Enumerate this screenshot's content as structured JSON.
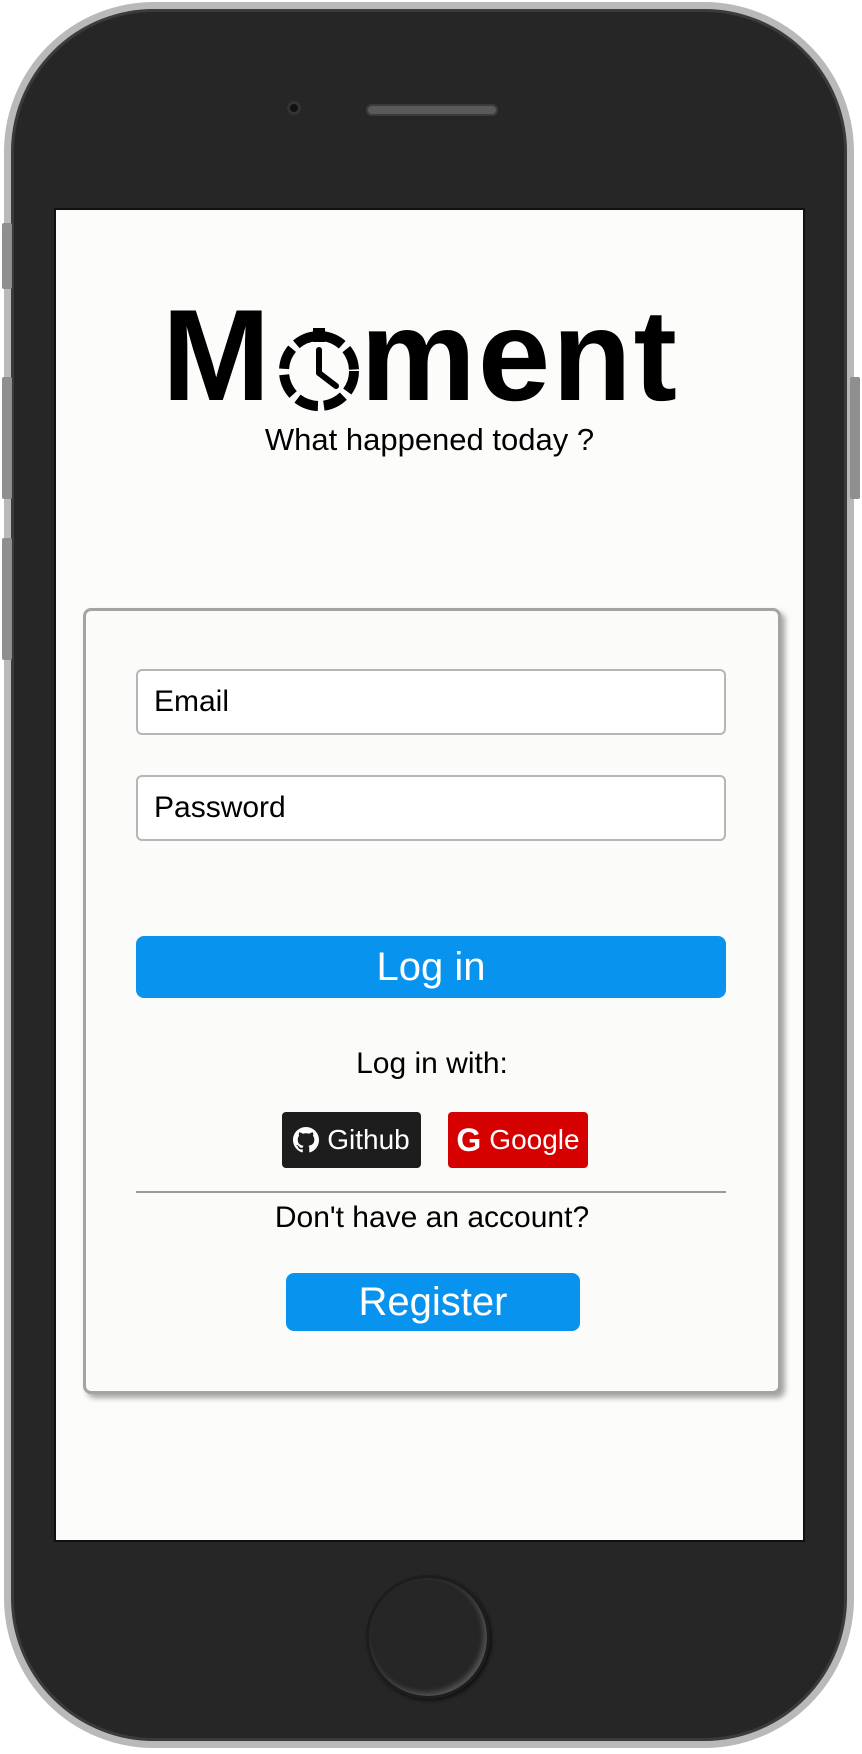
{
  "app": {
    "logo_text": "Moment",
    "tagline": "What happened today ?"
  },
  "login_form": {
    "email_placeholder": "Email",
    "password_placeholder": "Password",
    "login_label": "Log in",
    "login_with_label": "Log in with:",
    "github_label": "Github",
    "google_label": "Google",
    "no_account_text": "Don't have an account?",
    "register_label": "Register"
  },
  "icons": {
    "clock": "clock-icon",
    "github": "github-icon",
    "google": "google-icon"
  },
  "colors": {
    "primary": "#0894ee",
    "github": "#1d1d1d",
    "google": "#d50000",
    "phone_body": "#262626",
    "phone_bezel": "#b9b9b9"
  }
}
